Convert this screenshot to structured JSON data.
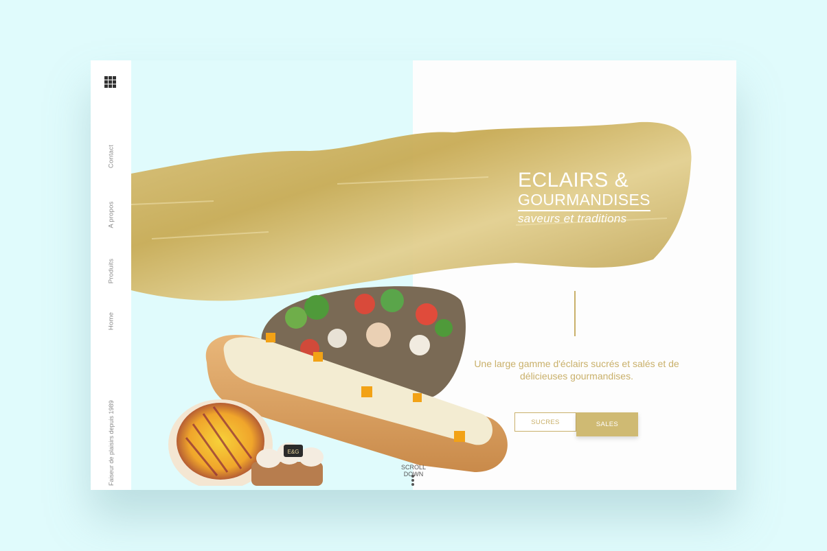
{
  "sidebar": {
    "menu_icon": "grid-menu-icon",
    "nav": [
      "Contact",
      "A propos",
      "Produits",
      "Home"
    ],
    "tagline": "Faiseur de plaisirs depuis 1989"
  },
  "brand": {
    "line1": "ECLAIRS &",
    "line2": "GOURMANDISES",
    "line3": "saveurs et traditions"
  },
  "hero": {
    "intro": "Une large gamme d'éclairs sucrés et salés et de délicieuses gourmandises.",
    "buttons": {
      "sucres": "SUCRES",
      "sales": "SALES"
    },
    "scroll": "SCROLL DOWN",
    "badge": "E&G"
  },
  "colors": {
    "background": "#e0fbfc",
    "gold": "#c9b06a",
    "gold_button": "#cfba73"
  }
}
